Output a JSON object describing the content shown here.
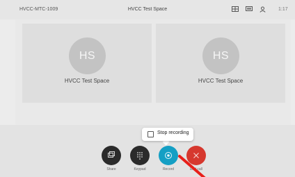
{
  "header": {
    "meeting_id": "HVCC-MTC-1009",
    "title": "HVCC Test Space",
    "time": "1:17"
  },
  "participants": [
    {
      "initials": "HS",
      "name": "HVCC Test Space"
    },
    {
      "initials": "HS",
      "name": "HVCC Test Space"
    }
  ],
  "tooltip": {
    "label": "Stop recording",
    "checked": false
  },
  "controls": {
    "share": {
      "label": "Share",
      "icon": "share-screen-icon",
      "color": "#2b2b2b"
    },
    "keypad": {
      "label": "Keypad",
      "icon": "keypad-icon",
      "color": "#2b2b2b"
    },
    "record": {
      "label": "Record",
      "icon": "record-icon",
      "color": "#149fc4"
    },
    "end": {
      "label": "End call",
      "icon": "close-icon",
      "color": "#d6382e"
    }
  },
  "top_icons": [
    "layout-icon",
    "screen-icon",
    "participants-icon"
  ],
  "annotation_color": "#e8201a"
}
